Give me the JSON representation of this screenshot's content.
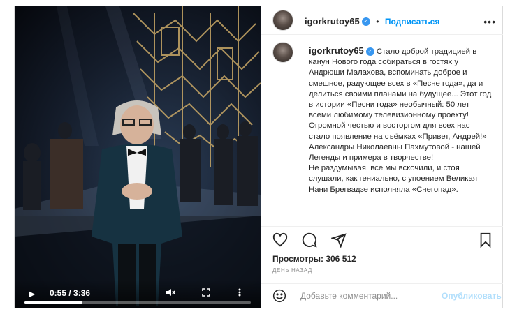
{
  "post": {
    "author": {
      "username": "igorkrutoy65",
      "verified_mark": "✓",
      "follow_label": "Подписаться",
      "more_glyph": "•••"
    },
    "caption": "Стало доброй традицией в канун Нового года собираться в гостях у Андрюши Малахова, вспоминать доброе и смешное, радующее всех в «Песне года», да и делиться своими планами на будущее... Этот год в истории «Песни года» необычный: 50 лет всеми любимому телевизионному проекту!\nОгромной честью и восторгом для всех нас стало появление на съёмках «Привет, Андрей!» Александры Николаевны Пахмутовой - нашей Легенды и примера в творчестве!\nНе раздумывая, все мы вскочили, и стоя слушали, как гениально, с упоением Великая Нани Брегвадзе исполняла «Снегопад».",
    "views_label": "Просмотры: 306 512",
    "time_ago": "ДЕНЬ НАЗАД",
    "comment": {
      "placeholder": "Добавьте комментарий...",
      "publish_label": "Опубликовать"
    }
  },
  "video": {
    "current_time": "0:55",
    "duration": "3:36",
    "time_display": "0:55 / 3:36",
    "progress_fraction": 0.255,
    "icons": [
      "play-icon",
      "mute-icon",
      "fullscreen-icon",
      "more-vertical-icon"
    ]
  },
  "action_icons": [
    "heart-icon",
    "comment-icon",
    "share-icon",
    "bookmark-icon"
  ],
  "colors": {
    "link_blue": "#0095f6",
    "publish_disabled": "#b2dffc",
    "muted_text": "#8e8e8e",
    "border": "#dbdbdb"
  }
}
